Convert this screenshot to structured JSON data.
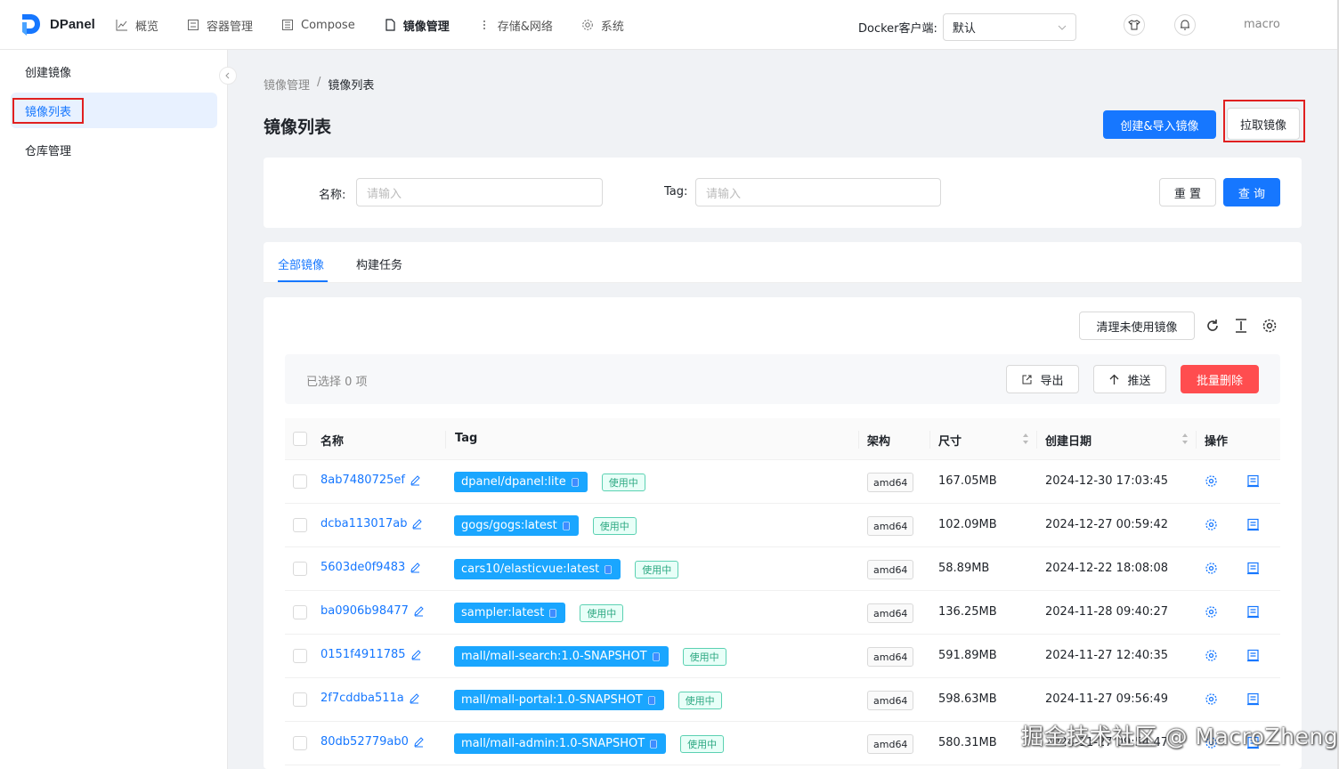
{
  "brand": {
    "name": "DPanel",
    "accent": "#1677ff"
  },
  "nav": [
    {
      "label": "概览",
      "icon": "chart-icon"
    },
    {
      "label": "容器管理",
      "icon": "container-icon"
    },
    {
      "label": "Compose",
      "icon": "compose-icon"
    },
    {
      "label": "镜像管理",
      "icon": "image-doc-icon"
    },
    {
      "label": "存储&网络",
      "icon": "storage-icon"
    },
    {
      "label": "系统",
      "icon": "gear-icon"
    }
  ],
  "docker_client": {
    "label": "Docker客户端:",
    "value": "默认"
  },
  "user": "macro",
  "sidebar": [
    {
      "label": "创建镜像"
    },
    {
      "label": "镜像列表"
    },
    {
      "label": "仓库管理"
    }
  ],
  "breadcrumb": [
    "镜像管理",
    "/",
    "镜像列表"
  ],
  "page_title": "镜像列表",
  "actions": {
    "create_import": "创建&导入镜像",
    "pull": "拉取镜像"
  },
  "search": {
    "name_label": "名称:",
    "name_placeholder": "请输入",
    "tag_label": "Tag:",
    "tag_placeholder": "请输入",
    "reset": "重 置",
    "query": "查 询"
  },
  "tabs": [
    "全部镜像",
    "构建任务"
  ],
  "toolbar": {
    "prune": "清理未使用镜像"
  },
  "selection": {
    "text": "已选择 0 项",
    "export": "导出",
    "push": "推送",
    "batch_delete": "批量删除"
  },
  "columns": {
    "name": "名称",
    "tag": "Tag",
    "arch": "架构",
    "size": "尺寸",
    "created": "创建日期",
    "ops": "操作"
  },
  "in_use_label": "使用中",
  "rows": [
    {
      "id": "8ab7480725ef",
      "tag": "dpanel/dpanel:lite",
      "arch": "amd64",
      "size": "167.05MB",
      "created": "2024-12-30 17:03:45"
    },
    {
      "id": "dcba113017ab",
      "tag": "gogs/gogs:latest",
      "arch": "amd64",
      "size": "102.09MB",
      "created": "2024-12-27 00:59:42"
    },
    {
      "id": "5603de0f9483",
      "tag": "cars10/elasticvue:latest",
      "arch": "amd64",
      "size": "58.89MB",
      "created": "2024-12-22 18:08:08"
    },
    {
      "id": "ba0906b98477",
      "tag": "sampler:latest",
      "arch": "amd64",
      "size": "136.25MB",
      "created": "2024-11-28 09:40:27"
    },
    {
      "id": "0151f4911785",
      "tag": "mall/mall-search:1.0-SNAPSHOT",
      "arch": "amd64",
      "size": "591.89MB",
      "created": "2024-11-27 12:40:35"
    },
    {
      "id": "2f7cddba511a",
      "tag": "mall/mall-portal:1.0-SNAPSHOT",
      "arch": "amd64",
      "size": "598.63MB",
      "created": "2024-11-27 09:56:49"
    },
    {
      "id": "80db52779ab0",
      "tag": "mall/mall-admin:1.0-SNAPSHOT",
      "arch": "amd64",
      "size": "580.31MB",
      "created": "2024-11-27 09:54:47"
    }
  ],
  "watermark": "掘金技术社区 @ MacroZheng"
}
